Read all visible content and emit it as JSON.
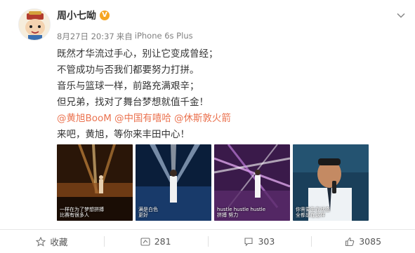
{
  "post": {
    "author": "周小七呦",
    "verified_badge": "V",
    "date": "8月27日 20:37",
    "source_prefix": "来自",
    "source_device": "iPhone 6s Plus",
    "lines": [
      "既然才华流过手心，别让它变成曾经；",
      "不管成功与否我们都要努力打拼。",
      "音乐与篮球一样，前路充满艰辛；",
      "但兄弟，找对了舞台梦想就值千金！"
    ],
    "mentions": [
      "@黄旭BooM",
      "@中国有嘻哈",
      "@休斯敦火箭"
    ],
    "closing": "来吧，黄旭，等你来丰田中心！",
    "images": [
      {
        "icon": "stage-performance-photo",
        "captions": [
          "一样在为了梦想拼搏",
          "比赛有很多人"
        ]
      },
      {
        "icon": "stage-performance-photo",
        "captions": [
          "满是白色",
          "更好"
        ]
      },
      {
        "icon": "stage-performance-photo",
        "captions": [
          "hustle hustle hustle",
          "拼搏 努力"
        ]
      },
      {
        "icon": "stage-closeup-photo",
        "captions": [
          "你需要生存状态",
          "全都是在这样"
        ]
      }
    ]
  },
  "actions": {
    "favorite_label": "收藏",
    "repost_count": "281",
    "comment_count": "303",
    "like_count": "3085"
  },
  "colors": {
    "mention": "#eb7350",
    "badge": "#f6a623",
    "meta": "#808080"
  }
}
